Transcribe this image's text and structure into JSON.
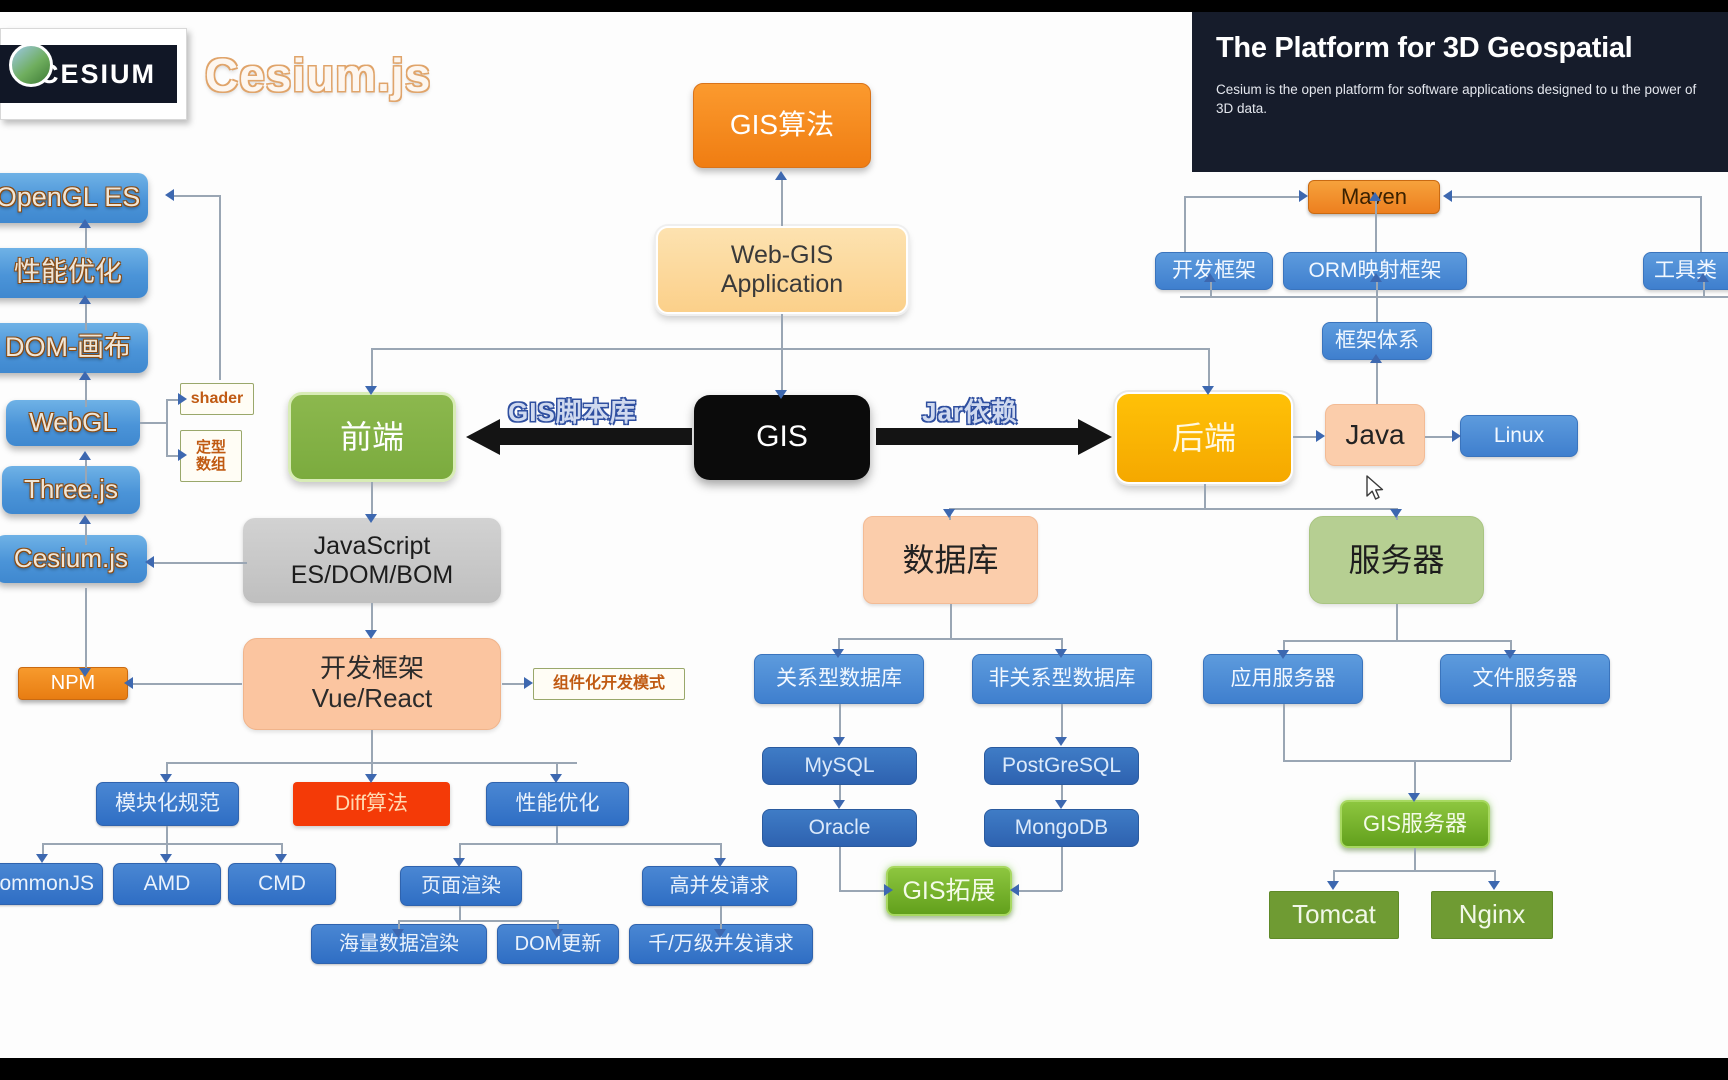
{
  "brand": {
    "logo_word": "CESIUM",
    "wordmark": "Cesium.js"
  },
  "promo": {
    "title": "The Platform for 3D Geospatial",
    "body": "Cesium is the open platform for software applications designed to u the power of 3D data."
  },
  "nodes": {
    "opengl_es": "OpenGL ES",
    "perf_left": "性能优化",
    "dom_canvas": "DOM-画布",
    "webgl": "WebGL",
    "threejs": "Three.js",
    "cesiumjs": "Cesium.js",
    "shader": "shader",
    "typed_array": "定型\n数组",
    "npm": "NPM",
    "gis_algorithm": "GIS算法",
    "webgis_app": "Web-GIS\nApplication",
    "frontend": "前端",
    "gis": "GIS",
    "backend": "后端",
    "javascript": "JavaScript\nES/DOM/BOM",
    "dev_framework": "开发框架\nVue/React",
    "component_dev": "组件化开发模式",
    "module_spec": "模块化规范",
    "diff_algorithm": "Diff算法",
    "perf_opt": "性能优化",
    "commonjs": "ommonJS",
    "amd": "AMD",
    "cmd": "CMD",
    "page_render": "页面渲染",
    "high_concurrency": "高并发请求",
    "mass_data_render": "海量数据渲染",
    "dom_update": "DOM更新",
    "k_m_concurrency": "千/万级并发请求",
    "database": "数据库",
    "relational_db": "关系型数据库",
    "nonrelational_db": "非关系型数据库",
    "mysql": "MySQL",
    "oracle": "Oracle",
    "postgresql": "PostGreSQL",
    "mongodb": "MongoDB",
    "gis_extension": "GIS拓展",
    "maven": "Maven",
    "dev_framework_java": "开发框架",
    "orm_framework": "ORM映射框架",
    "tool_class": "工具类",
    "framework_system": "框架体系",
    "java": "Java",
    "linux": "Linux",
    "server": "服务器",
    "app_server": "应用服务器",
    "file_server": "文件服务器",
    "gis_server": "GIS服务器",
    "tomcat": "Tomcat",
    "nginx": "Nginx"
  },
  "edges": {
    "gis_script_lib": "GIS脚本库",
    "jar_dependency": "Jar依赖"
  },
  "colors": {
    "blue": "#3f7fce",
    "orange": "#ef7f1d",
    "amber": "#f5a800",
    "green": "#7bab3e",
    "red": "#f43a07",
    "black": "#0b0b0b",
    "peach": "#fbc5a0",
    "cream": "#fbd08a",
    "gray": "#c6c6c6",
    "connector": "#9aa6b4",
    "arrowhead": "#3d68b0"
  }
}
